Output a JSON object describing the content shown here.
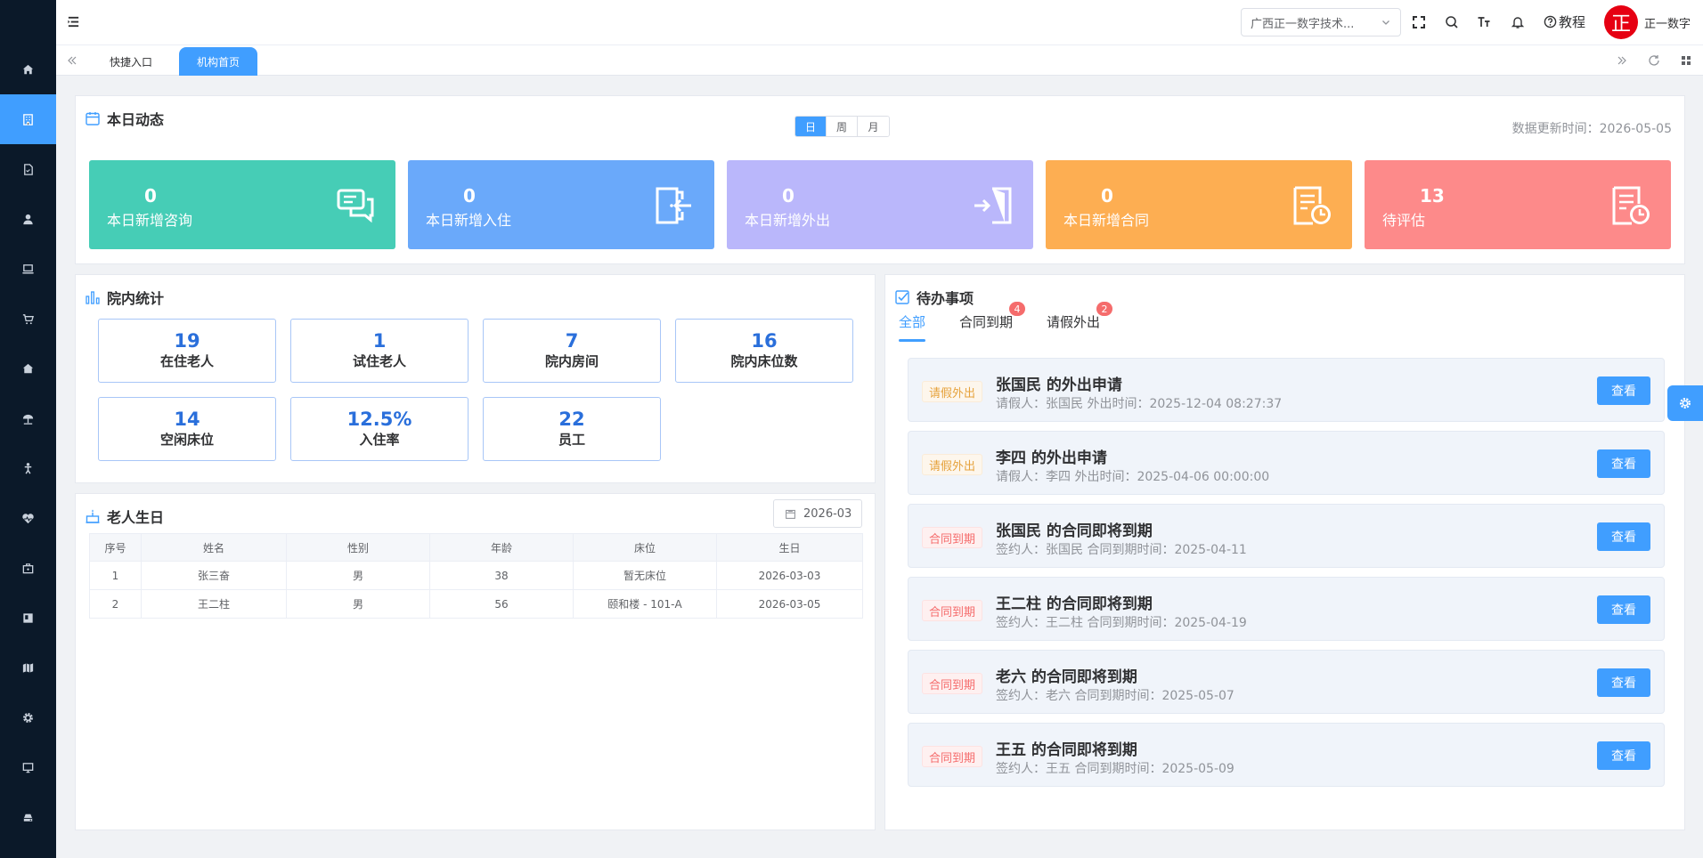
{
  "sidebar": {
    "items": [
      {
        "icon": "home-icon",
        "active": false
      },
      {
        "icon": "building-icon",
        "active": true
      },
      {
        "icon": "document-icon",
        "active": false
      },
      {
        "icon": "user-icon",
        "active": false
      },
      {
        "icon": "laptop-icon",
        "active": false
      },
      {
        "icon": "cart-icon",
        "active": false
      },
      {
        "icon": "house-icon",
        "active": false
      },
      {
        "icon": "umbrella-icon",
        "active": false
      },
      {
        "icon": "person-icon",
        "active": false
      },
      {
        "icon": "heart-pulse-icon",
        "active": false
      },
      {
        "icon": "briefcase-icon",
        "active": false
      },
      {
        "icon": "panel-icon",
        "active": false
      },
      {
        "icon": "map-icon",
        "active": false
      },
      {
        "icon": "gear-icon",
        "active": false
      },
      {
        "icon": "monitor-icon",
        "active": false
      },
      {
        "icon": "drive-icon",
        "active": false
      }
    ]
  },
  "header": {
    "org_select": "广西正一数字技术...",
    "tutorial": "教程",
    "avatar_char": "正",
    "username": "正一数字"
  },
  "tabs": [
    {
      "label": "快捷入口",
      "active": false
    },
    {
      "label": "机构首页",
      "active": true
    }
  ],
  "today": {
    "title": "本日动态",
    "segments": [
      "日",
      "周",
      "月"
    ],
    "active_segment": "日",
    "update_label": "数据更新时间：2026-05-05",
    "cards": [
      {
        "value": "0",
        "label": "本日新增咨询",
        "color": "#46cdb6",
        "icon": "chat-icon"
      },
      {
        "value": "0",
        "label": "本日新增入住",
        "color": "#6aa9fa",
        "icon": "check-in-icon"
      },
      {
        "value": "0",
        "label": "本日新增外出",
        "color": "#bab7fb",
        "icon": "exit-icon"
      },
      {
        "value": "0",
        "label": "本日新增合同",
        "color": "#fdae52",
        "icon": "contract-icon"
      },
      {
        "value": "13",
        "label": "待评估",
        "color": "#fd8a8a",
        "icon": "assessment-icon"
      }
    ]
  },
  "stats": {
    "title": "院内统计",
    "items": [
      {
        "value": "19",
        "label": "在住老人"
      },
      {
        "value": "1",
        "label": "试住老人"
      },
      {
        "value": "7",
        "label": "院内房间"
      },
      {
        "value": "16",
        "label": "院内床位数"
      },
      {
        "value": "14",
        "label": "空闲床位"
      },
      {
        "value": "12.5%",
        "label": "入住率"
      },
      {
        "value": "22",
        "label": "员工"
      }
    ]
  },
  "birthday": {
    "title": "老人生日",
    "month": "2026-03",
    "columns": [
      "序号",
      "姓名",
      "性别",
      "年龄",
      "床位",
      "生日"
    ],
    "rows": [
      [
        "1",
        "张三奋",
        "男",
        "38",
        "暂无床位",
        "2026-03-03"
      ],
      [
        "2",
        "王二柱",
        "男",
        "56",
        "颐和楼 - 101-A",
        "2026-03-05"
      ]
    ]
  },
  "todo": {
    "title": "待办事项",
    "tabs": [
      {
        "label": "全部",
        "badge": ""
      },
      {
        "label": "合同到期",
        "badge": "4"
      },
      {
        "label": "请假外出",
        "badge": "2"
      }
    ],
    "button_label": "查看",
    "items": [
      {
        "tag": "请假外出",
        "type": "leave",
        "title": "张国民 的外出申请",
        "sub": "请假人：张国民 外出时间：2025-12-04 08:27:37"
      },
      {
        "tag": "请假外出",
        "type": "leave",
        "title": "李四 的外出申请",
        "sub": "请假人：李四 外出时间：2025-04-06 00:00:00"
      },
      {
        "tag": "合同到期",
        "type": "contract",
        "title": "张国民 的合同即将到期",
        "sub": "签约人：张国民 合同到期时间：2025-04-11"
      },
      {
        "tag": "合同到期",
        "type": "contract",
        "title": "王二柱 的合同即将到期",
        "sub": "签约人：王二柱 合同到期时间：2025-04-19"
      },
      {
        "tag": "合同到期",
        "type": "contract",
        "title": "老六 的合同即将到期",
        "sub": "签约人：老六 合同到期时间：2025-05-07"
      },
      {
        "tag": "合同到期",
        "type": "contract",
        "title": "王五 的合同即将到期",
        "sub": "签约人：王五 合同到期时间：2025-05-09"
      }
    ]
  }
}
